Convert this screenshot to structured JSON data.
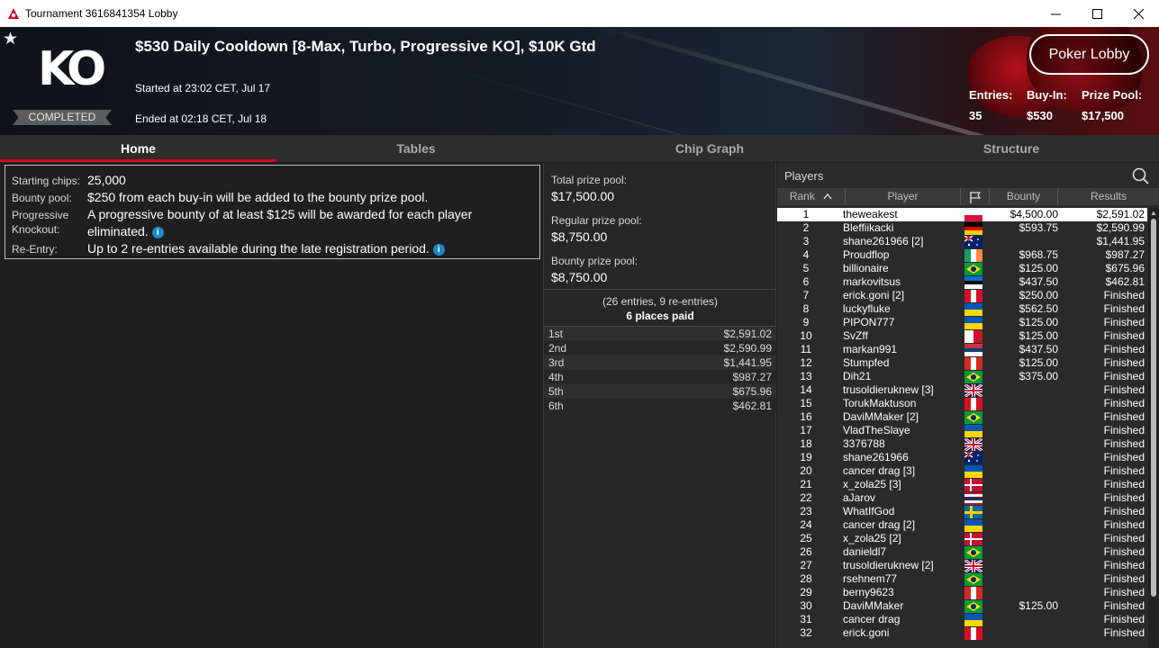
{
  "window": {
    "title": "Tournament 3616841354 Lobby",
    "minimize": "—",
    "maximize": "☐",
    "close": "✕"
  },
  "header": {
    "star": "★",
    "logo_text": "KO",
    "status": "COMPLETED",
    "title": "$530 Daily Cooldown [8-Max, Turbo, Progressive KO], $10K Gtd",
    "started": "Started at 23:02 CET, Jul 17",
    "ended": "Ended at 02:18 CET, Jul 18",
    "lobby_button": "Poker Lobby",
    "stats": [
      {
        "label": "Entries:",
        "value": "35"
      },
      {
        "label": "Buy-In:",
        "value": "$530"
      },
      {
        "label": "Prize Pool:",
        "value": "$17,500"
      }
    ]
  },
  "tabs": [
    {
      "label": "Home",
      "active": true
    },
    {
      "label": "Tables",
      "active": false
    },
    {
      "label": "Chip Graph",
      "active": false
    },
    {
      "label": "Structure",
      "active": false
    }
  ],
  "info": {
    "starting_chips_label": "Starting chips:",
    "starting_chips": "25,000",
    "bounty_pool_label": "Bounty pool:",
    "bounty_pool": "$250 from each buy-in will be added to the bounty prize pool.",
    "progressive_label": "Progressive Knockout:",
    "progressive": "A progressive bounty of at least $125 will be awarded for each player eliminated.",
    "reentry_label": "Re-Entry:",
    "reentry": "Up to 2 re-entries available during the late registration period.",
    "info_icon": "i"
  },
  "prize": {
    "total_label": "Total prize pool:",
    "total": "$17,500.00",
    "regular_label": "Regular prize pool:",
    "regular": "$8,750.00",
    "bounty_label": "Bounty prize pool:",
    "bounty": "$8,750.00",
    "entries_note": "(26 entries, 9 re-entries)",
    "places_paid": "6 places paid",
    "payouts": [
      {
        "place": "1st",
        "amount": "$2,591.02"
      },
      {
        "place": "2nd",
        "amount": "$2,590.99"
      },
      {
        "place": "3rd",
        "amount": "$1,441.95"
      },
      {
        "place": "4th",
        "amount": "$987.27"
      },
      {
        "place": "5th",
        "amount": "$675.96"
      },
      {
        "place": "6th",
        "amount": "$462.81"
      }
    ]
  },
  "players": {
    "title": "Players",
    "columns": {
      "rank": "Rank",
      "player": "Player",
      "bounty": "Bounty",
      "results": "Results"
    },
    "rows": [
      {
        "rank": "1",
        "name": "theweakest",
        "flag": "pl",
        "bounty": "$4,500.00",
        "result": "$2,591.02",
        "selected": true
      },
      {
        "rank": "2",
        "name": "Bleffiikacki",
        "flag": "de",
        "bounty": "$593.75",
        "result": "$2,590.99"
      },
      {
        "rank": "3",
        "name": "shane261966 [2]",
        "flag": "au",
        "bounty": "",
        "result": "$1,441.95"
      },
      {
        "rank": "4",
        "name": "Proudflop",
        "flag": "ie",
        "bounty": "$968.75",
        "result": "$987.27"
      },
      {
        "rank": "5",
        "name": "billionaire",
        "flag": "br",
        "bounty": "$125.00",
        "result": "$675.96"
      },
      {
        "rank": "6",
        "name": "markovitsus",
        "flag": "ee",
        "bounty": "$437.50",
        "result": "$462.81"
      },
      {
        "rank": "7",
        "name": "erick.goni [2]",
        "flag": "pe",
        "bounty": "$250.00",
        "result": "Finished"
      },
      {
        "rank": "8",
        "name": "luckyfluke",
        "flag": "ua",
        "bounty": "$562.50",
        "result": "Finished"
      },
      {
        "rank": "9",
        "name": "PIPON777",
        "flag": "ua",
        "bounty": "$125.00",
        "result": "Finished"
      },
      {
        "rank": "10",
        "name": "SvZff",
        "flag": "mt",
        "bounty": "$125.00",
        "result": "Finished"
      },
      {
        "rank": "11",
        "name": "markan991",
        "flag": "rs",
        "bounty": "$437.50",
        "result": "Finished"
      },
      {
        "rank": "12",
        "name": "Stumpfed",
        "flag": "ca",
        "bounty": "$125.00",
        "result": "Finished"
      },
      {
        "rank": "13",
        "name": "Dih21",
        "flag": "br",
        "bounty": "$375.00",
        "result": "Finished"
      },
      {
        "rank": "14",
        "name": "trusoldieruknew [3]",
        "flag": "gb",
        "bounty": "",
        "result": "Finished"
      },
      {
        "rank": "15",
        "name": "TorukMaktuson",
        "flag": "pe",
        "bounty": "",
        "result": "Finished"
      },
      {
        "rank": "16",
        "name": "DaviMMaker [2]",
        "flag": "br",
        "bounty": "",
        "result": "Finished"
      },
      {
        "rank": "17",
        "name": "VladTheSlaye",
        "flag": "ua",
        "bounty": "",
        "result": "Finished"
      },
      {
        "rank": "18",
        "name": "3376788",
        "flag": "gb",
        "bounty": "",
        "result": "Finished"
      },
      {
        "rank": "19",
        "name": "shane261966",
        "flag": "au",
        "bounty": "",
        "result": "Finished"
      },
      {
        "rank": "20",
        "name": "cancer drag [3]",
        "flag": "ua",
        "bounty": "",
        "result": "Finished"
      },
      {
        "rank": "21",
        "name": "x_zola25 [3]",
        "flag": "dk",
        "bounty": "",
        "result": "Finished"
      },
      {
        "rank": "22",
        "name": "aJarov",
        "flag": "th",
        "bounty": "",
        "result": "Finished"
      },
      {
        "rank": "23",
        "name": "WhatIfGod",
        "flag": "se",
        "bounty": "",
        "result": "Finished"
      },
      {
        "rank": "24",
        "name": "cancer drag [2]",
        "flag": "ua",
        "bounty": "",
        "result": "Finished"
      },
      {
        "rank": "25",
        "name": "x_zola25 [2]",
        "flag": "dk",
        "bounty": "",
        "result": "Finished"
      },
      {
        "rank": "26",
        "name": "danieldl7",
        "flag": "br",
        "bounty": "",
        "result": "Finished"
      },
      {
        "rank": "27",
        "name": "trusoldieruknew [2]",
        "flag": "gb",
        "bounty": "",
        "result": "Finished"
      },
      {
        "rank": "28",
        "name": "rsehnem77",
        "flag": "br",
        "bounty": "",
        "result": "Finished"
      },
      {
        "rank": "29",
        "name": "berny9623",
        "flag": "ca",
        "bounty": "",
        "result": "Finished"
      },
      {
        "rank": "30",
        "name": "DaviMMaker",
        "flag": "br",
        "bounty": "$125.00",
        "result": "Finished"
      },
      {
        "rank": "31",
        "name": "cancer drag",
        "flag": "ua",
        "bounty": "",
        "result": "Finished"
      },
      {
        "rank": "32",
        "name": "erick.goni",
        "flag": "pe",
        "bounty": "",
        "result": "Finished"
      }
    ]
  },
  "colors": {
    "accent": "#d0021b",
    "info_icon": "#1d89c4",
    "background": "#1f1f1f",
    "selected_row": "#ffffff"
  }
}
